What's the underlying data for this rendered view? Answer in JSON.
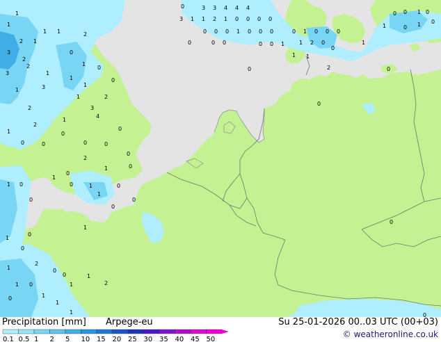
{
  "legend": {
    "title": "Precipitation [mm]",
    "model": "Arpege-eu",
    "date": "Su 25-01-2026 00..03 UTC (00+03)",
    "credit": "weatheronline.co.uk",
    "credit_mark": "©",
    "scale_labels": [
      "0.1",
      "0.5",
      "1",
      "2",
      "5",
      "10",
      "15",
      "20",
      "25",
      "30",
      "35",
      "40",
      "45",
      "50"
    ],
    "scale_colors": [
      "#aeeefe",
      "#96e6f9",
      "#78d6f4",
      "#5ec4ee",
      "#40aee6",
      "#2895de",
      "#1f79d2",
      "#1a56c4",
      "#1e34b4",
      "#4a18c8",
      "#7d16cc",
      "#b00ec8",
      "#d80ec6",
      "#f000d6"
    ]
  },
  "map": {
    "colors": {
      "sea": "#e4e4e4",
      "land": "#c4f292",
      "precip_light": "#aeeefe",
      "precip_medium": "#78d6f4",
      "precip_heavy": "#40aee6",
      "border": "#6b7a6b",
      "coast": "#8b8b8b"
    },
    "value_labels": [
      "1",
      "2",
      "3",
      "1",
      "2",
      "1",
      "1",
      "2",
      "0",
      "0",
      "1",
      "0",
      "2",
      "1",
      "3",
      "1",
      "3",
      "2",
      "1",
      "2",
      "3",
      "1",
      "2",
      "1",
      "1",
      "1",
      "4",
      "0",
      "0",
      "0",
      "0",
      "0",
      "1",
      "0",
      "1",
      "0",
      "0",
      "1",
      "0",
      "0",
      "0",
      "0",
      "1",
      "2",
      "0",
      "1",
      "1",
      "0",
      "0",
      "0",
      "1",
      "0",
      "2",
      "1",
      "1",
      "0",
      "0",
      "1",
      "0",
      "0",
      "1",
      "1",
      "1",
      "1",
      "2",
      "1",
      "0",
      "3",
      "3",
      "4",
      "4",
      "4",
      "3",
      "1",
      "1",
      "2",
      "1",
      "0",
      "0",
      "0",
      "0",
      "0",
      "0",
      "0",
      "1",
      "0",
      "0",
      "0",
      "0",
      "0",
      "0",
      "0",
      "0",
      "1",
      "0",
      "1",
      "0",
      "0",
      "0",
      "1",
      "2",
      "0",
      "0",
      "1",
      "1",
      "2",
      "1",
      "1",
      "0",
      "0",
      "1",
      "0",
      "0",
      "1",
      "0",
      "0",
      "0",
      "0",
      "0",
      "0"
    ]
  }
}
